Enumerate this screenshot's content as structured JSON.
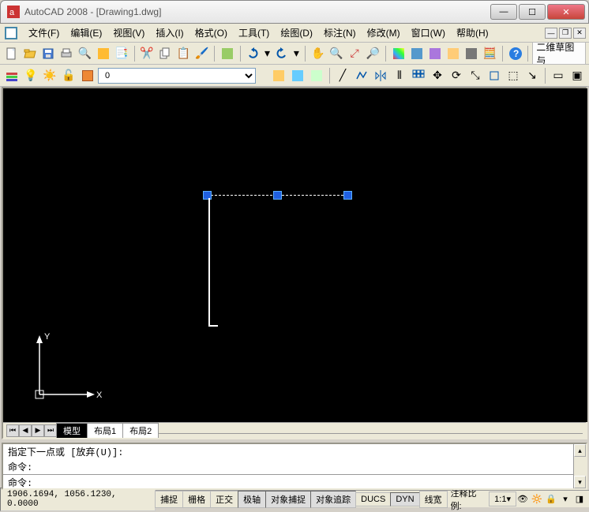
{
  "title": "AutoCAD 2008 - [Drawing1.dwg]",
  "menus": {
    "file": "文件(F)",
    "edit": "编辑(E)",
    "view": "视图(V)",
    "insert": "插入(I)",
    "format": "格式(O)",
    "tools": "工具(T)",
    "draw": "绘图(D)",
    "label": "标注(N)",
    "modify": "修改(M)",
    "window": "窗口(W)",
    "help": "帮助(H)"
  },
  "workspace_label": "二维草图与",
  "layer_combo": "0",
  "layout_tabs": {
    "model": "模型",
    "layout1": "布局1",
    "layout2": "布局2"
  },
  "command": {
    "line1": "指定下一点或 [放弃(U)]:",
    "line2": "命令:",
    "line3": "命令:"
  },
  "status": {
    "coords": "1906.1694, 1056.1230, 0.0000",
    "snap": "捕捉",
    "grid": "栅格",
    "ortho": "正交",
    "polar": "极轴",
    "osnap": "对象捕捉",
    "otrack": "对象追踪",
    "ducs": "DUCS",
    "dyn": "DYN",
    "lwt": "线宽",
    "anno": "注释比例:",
    "anno_val": "1:1"
  },
  "ucs": {
    "x": "X",
    "y": "Y"
  },
  "icons": {
    "new": "new-icon",
    "open": "open-icon",
    "save": "save-icon",
    "plot": "plot-icon",
    "cut": "cut-icon",
    "copy": "copy-icon",
    "paste": "paste-icon",
    "undo": "undo-icon",
    "redo": "redo-icon",
    "pan": "pan-icon",
    "zoomin": "zoom-in-icon",
    "zoomout": "zoom-out-icon",
    "help": "help-icon"
  }
}
